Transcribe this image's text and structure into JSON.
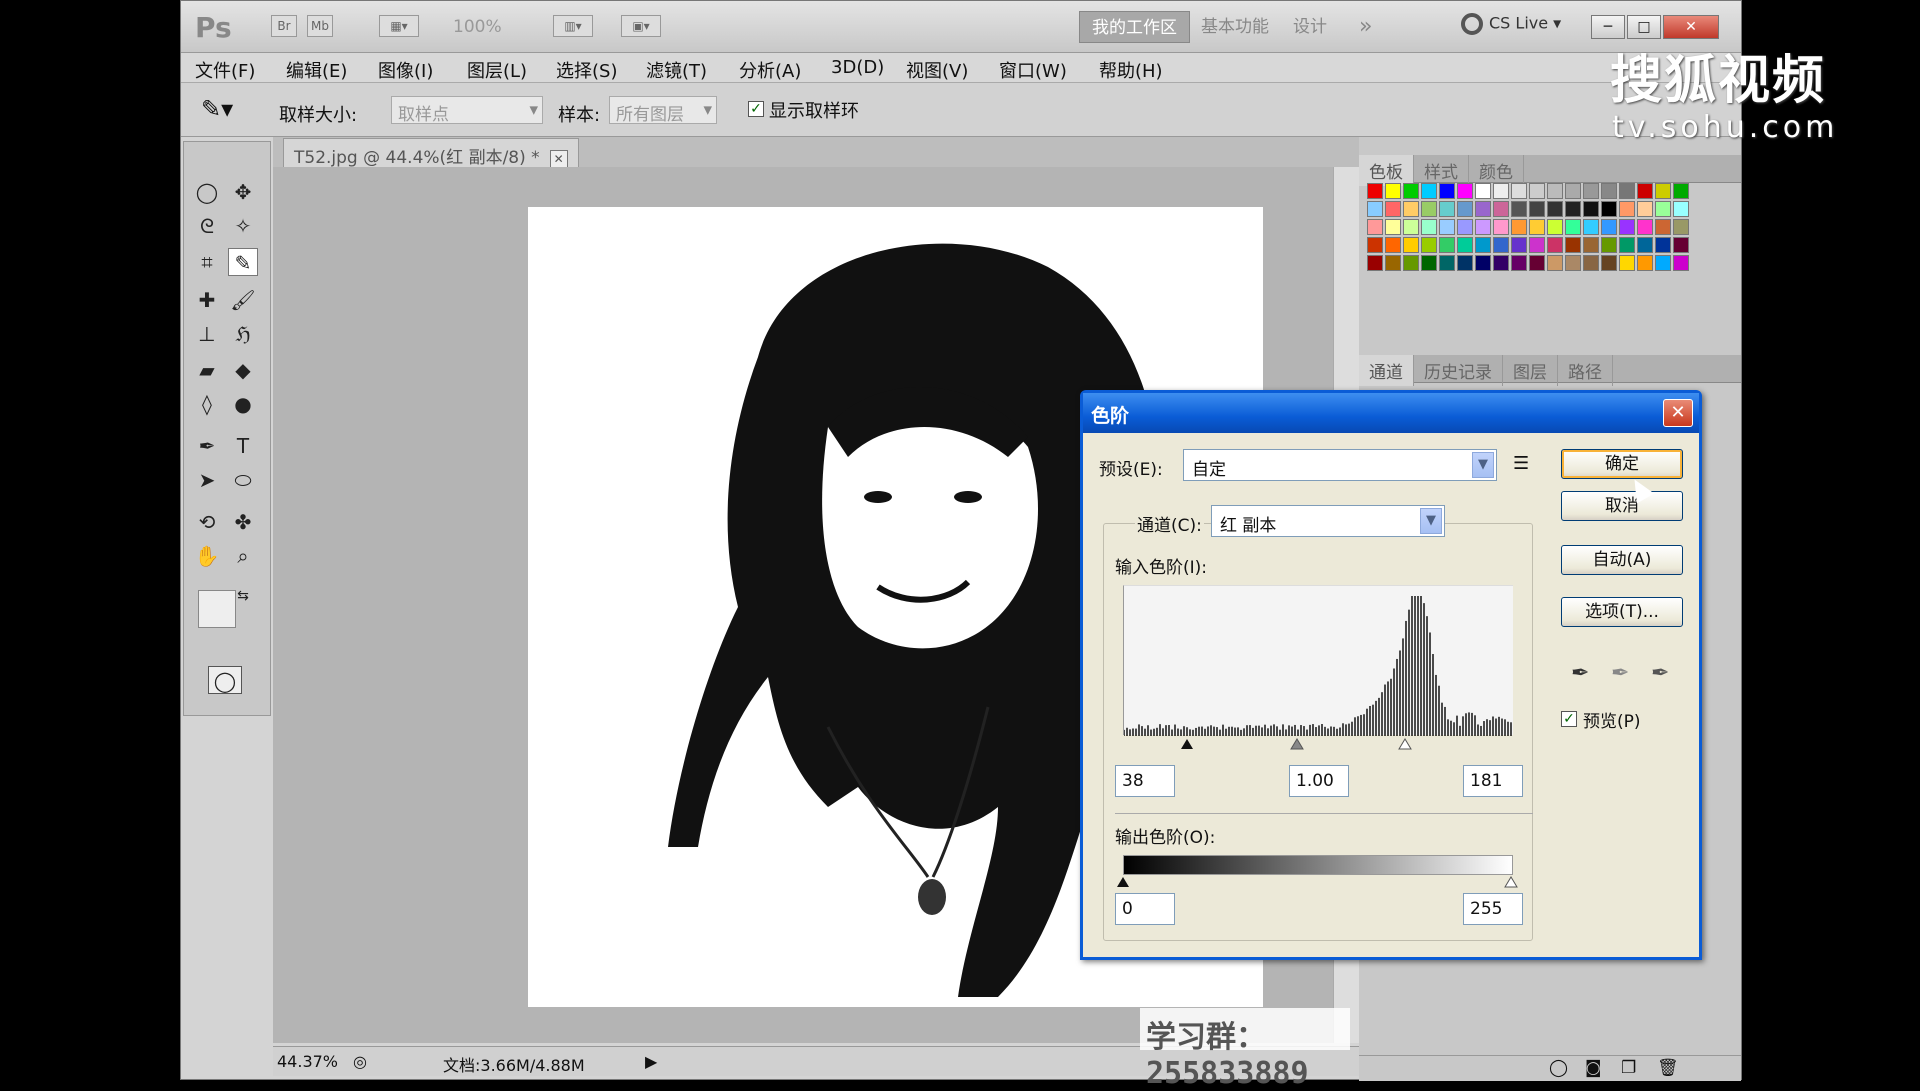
{
  "titlebar": {
    "app_logo": "Ps",
    "zoom": "100%",
    "workspaces": [
      "我的工作区",
      "基本功能",
      "设计"
    ],
    "more": "»",
    "cs_live": "CS Live"
  },
  "menu": [
    "文件(F)",
    "编辑(E)",
    "图像(I)",
    "图层(L)",
    "选择(S)",
    "滤镜(T)",
    "分析(A)",
    "3D(D)",
    "视图(V)",
    "窗口(W)",
    "帮助(H)"
  ],
  "options": {
    "sample_size_label": "取样大小:",
    "sample_size_value": "取样点",
    "sample_label": "样本:",
    "sample_value": "所有图层",
    "show_ring_label": "显示取样环"
  },
  "document": {
    "tab_title": "T52.jpg @ 44.4%(红 副本/8) *"
  },
  "status": {
    "zoom": "44.37%",
    "doc_size": "文档:3.66M/4.88M"
  },
  "panels": {
    "top_tabs": [
      "色板",
      "样式",
      "颜色"
    ],
    "bottom_tabs": [
      "通道",
      "历史记录",
      "图层",
      "路径"
    ]
  },
  "dialog": {
    "title": "色阶",
    "preset_label": "预设(E):",
    "preset_value": "自定",
    "channel_label": "通道(C):",
    "channel_value": "红 副本",
    "input_label": "输入色阶(I):",
    "input_black": "38",
    "input_gamma": "1.00",
    "input_white": "181",
    "output_label": "输出色阶(O):",
    "output_black": "0",
    "output_white": "255",
    "buttons": {
      "ok": "确定",
      "cancel": "取消",
      "auto": "自动(A)",
      "options": "选项(T)..."
    },
    "preview_label": "预览(P)"
  },
  "overlays": {
    "watermark_brand": "搜狐视频",
    "watermark_url": "tv.sohu.com",
    "study_group": "学习群：255833889"
  },
  "colors": {
    "dialog_title": "#0a5cd6",
    "accent_button": "#f8b238"
  }
}
